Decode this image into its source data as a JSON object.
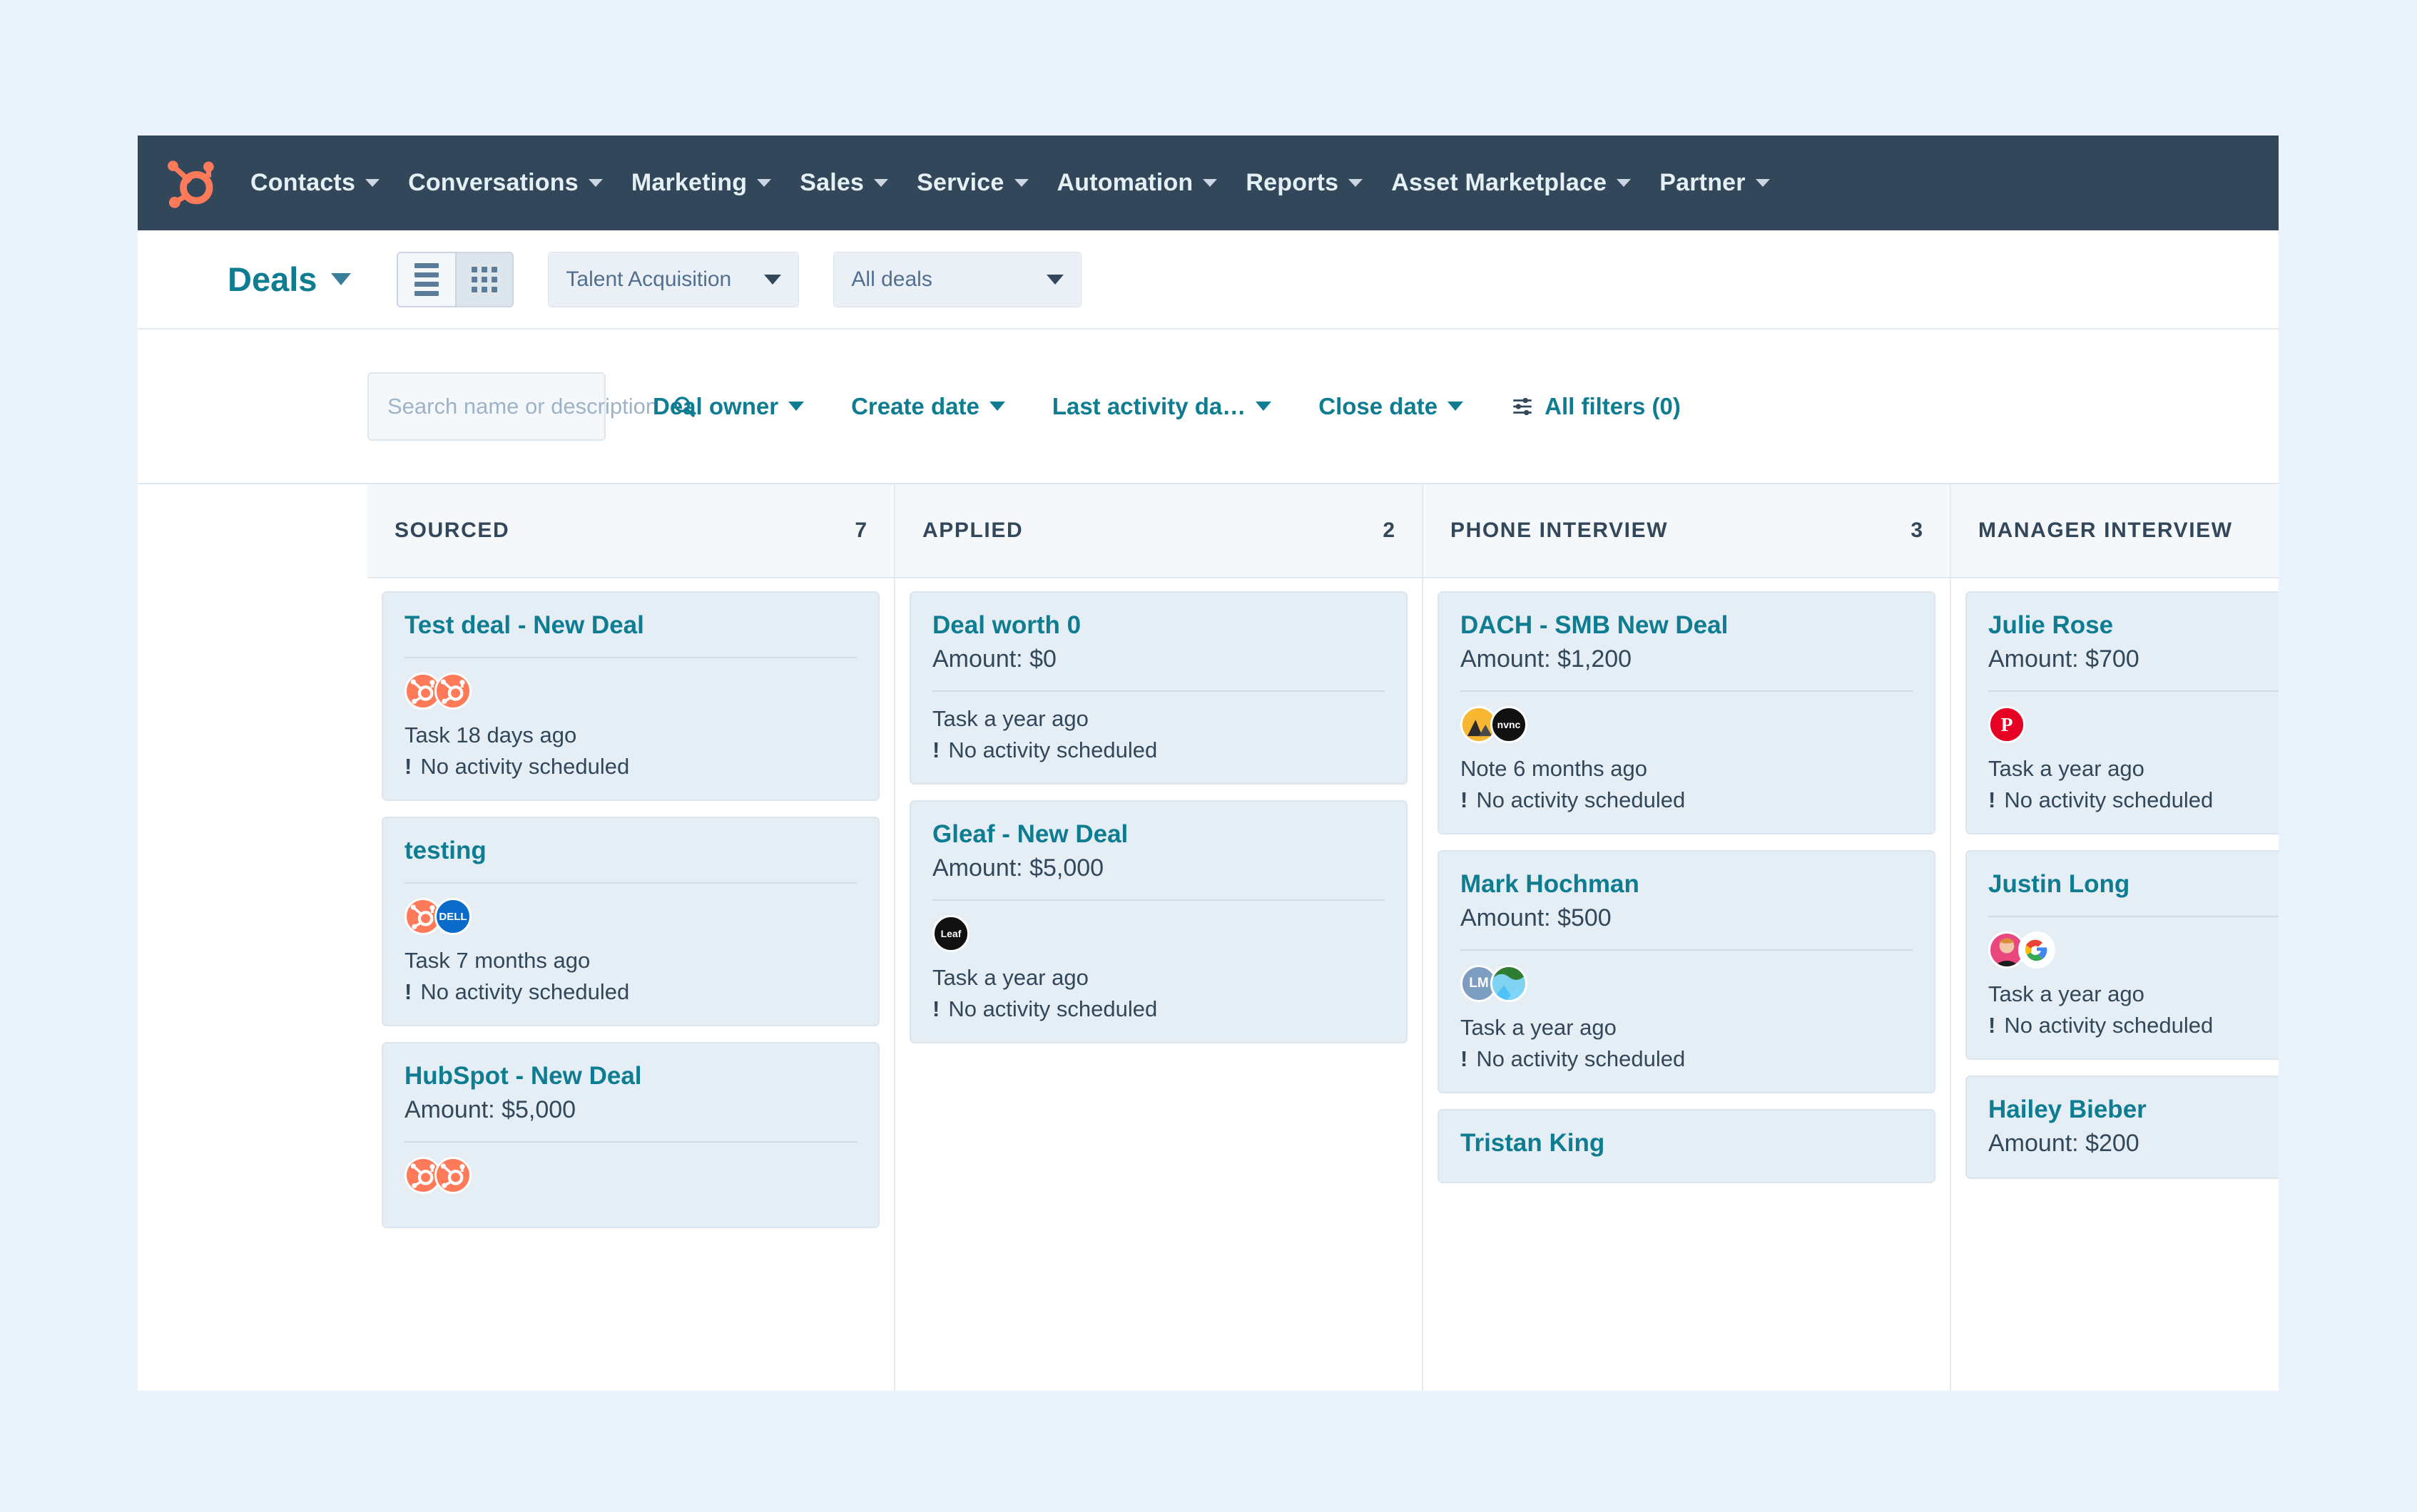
{
  "brand": {
    "accent": "#0e7c91",
    "nav_bg": "#33475b",
    "logo_color": "#ff7a59",
    "card_bg": "#e5eef5"
  },
  "topnav": {
    "logo": "hubspot-logo-icon",
    "items": [
      {
        "label": "Contacts"
      },
      {
        "label": "Conversations"
      },
      {
        "label": "Marketing"
      },
      {
        "label": "Sales"
      },
      {
        "label": "Service"
      },
      {
        "label": "Automation"
      },
      {
        "label": "Reports"
      },
      {
        "label": "Asset Marketplace"
      },
      {
        "label": "Partner"
      }
    ]
  },
  "toolbar": {
    "title": "Deals",
    "view_list_icon": "list-view-icon",
    "view_board_icon": "board-view-icon",
    "active_view": "board",
    "pipeline": "Talent Acquisition",
    "deal_scope": "All deals"
  },
  "filters": {
    "search_placeholder": "Search name or description",
    "search_value": "",
    "search_icon": "search-icon",
    "items": [
      {
        "label": "Deal owner"
      },
      {
        "label": "Create date"
      },
      {
        "label": "Last activity da…"
      },
      {
        "label": "Close date"
      }
    ],
    "all_filters": "All filters (0)",
    "all_filters_icon": "sliders-icon"
  },
  "board": {
    "columns": [
      {
        "name": "SOURCED",
        "count": "7",
        "cards": [
          {
            "title": "Test deal - New Deal",
            "amount": "",
            "avatars": [
              {
                "type": "hubspot",
                "label": ""
              },
              {
                "type": "hubspot",
                "label": ""
              }
            ],
            "meta": "Task 18 days ago",
            "warning": "No activity scheduled"
          },
          {
            "title": "testing",
            "amount": "",
            "avatars": [
              {
                "type": "hubspot",
                "label": ""
              },
              {
                "type": "dell",
                "label": "DELL"
              }
            ],
            "meta": "Task 7 months ago",
            "warning": "No activity scheduled"
          },
          {
            "title": "HubSpot - New Deal",
            "amount": "Amount: $5,000",
            "avatars": [
              {
                "type": "hubspot",
                "label": ""
              },
              {
                "type": "hubspot",
                "label": ""
              }
            ],
            "meta": "",
            "warning": ""
          }
        ]
      },
      {
        "name": "APPLIED",
        "count": "2",
        "cards": [
          {
            "title": "Deal worth 0",
            "amount": "Amount: $0",
            "avatars": [],
            "meta": "Task a year ago",
            "warning": "No activity scheduled"
          },
          {
            "title": "Gleaf - New Deal",
            "amount": "Amount: $5,000",
            "avatars": [
              {
                "type": "gleaf",
                "label": "Leaf"
              }
            ],
            "meta": "Task a year ago",
            "warning": "No activity scheduled"
          }
        ]
      },
      {
        "name": "PHONE INTERVIEW",
        "count": "3",
        "cards": [
          {
            "title": "DACH - SMB New Deal",
            "amount": "Amount: $1,200",
            "avatars": [
              {
                "type": "yellow-photo",
                "label": ""
              },
              {
                "type": "dark",
                "label": "nvnc"
              }
            ],
            "meta": "Note 6 months ago",
            "warning": "No activity scheduled"
          },
          {
            "title": "Mark Hochman",
            "amount": "Amount: $500",
            "avatars": [
              {
                "type": "initials",
                "label": "LM"
              },
              {
                "type": "landscape",
                "label": ""
              }
            ],
            "meta": "Task a year ago",
            "warning": "No activity scheduled"
          },
          {
            "title": "Tristan King",
            "amount": "",
            "avatars": [],
            "meta": "",
            "warning": ""
          }
        ]
      },
      {
        "name": "MANAGER INTERVIEW",
        "count": "",
        "cards": [
          {
            "title": "Julie Rose",
            "amount": "Amount: $700",
            "avatars": [
              {
                "type": "pinterest",
                "label": "P"
              }
            ],
            "meta": "Task a year ago",
            "warning": "No activity scheduled"
          },
          {
            "title": "Justin Long",
            "amount": "",
            "avatars": [
              {
                "type": "person-photo",
                "label": ""
              },
              {
                "type": "google",
                "label": "G"
              }
            ],
            "meta": "Task a year ago",
            "warning": "No activity scheduled"
          },
          {
            "title": "Hailey Bieber",
            "amount": "Amount: $200",
            "avatars": [],
            "meta": "",
            "warning": ""
          }
        ]
      }
    ]
  }
}
